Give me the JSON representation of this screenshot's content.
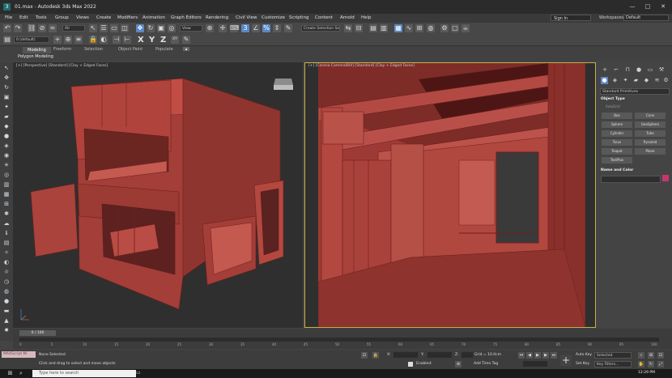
{
  "window": {
    "title": "01.max - Autodesk 3ds Max 2022",
    "minimize_icon": "minimize-icon",
    "maximize_icon": "maximize-icon",
    "close_icon": "close-icon"
  },
  "menu": {
    "items": [
      "File",
      "Edit",
      "Tools",
      "Group",
      "Views",
      "Create",
      "Modifiers",
      "Animation",
      "Graph Editors",
      "Rendering",
      "Civil View",
      "Customize",
      "Scripting",
      "Content",
      "Arnold",
      "Help"
    ],
    "sign_in": "Sign In",
    "workspaces_label": "Workspaces:",
    "workspace_value": "Default"
  },
  "toolbar": {
    "filter_all": "All",
    "view_dropdown": "View",
    "create_selection_set": "Create Selection Se",
    "axis_x": "X",
    "axis_y": "Y",
    "axis_z": "Z",
    "xy_label": "XY",
    "layer_dropdown": "0 (default)"
  },
  "ribbon": {
    "tabs": [
      "Modeling",
      "Freeform",
      "Selection",
      "Object Paint",
      "Populate"
    ],
    "active_tab": "Modeling",
    "sub_label": "Polygon Modeling"
  },
  "viewports": {
    "left_label": "[+] [Perspective] [Standard] [Clay + Edged Faces]",
    "right_label": "[+] [Corona Camera004] [Standard] [Clay + Edged Faces]"
  },
  "command_panel": {
    "category_dropdown": "Standard Primitives",
    "object_type_title": "Object Type",
    "autogrid_label": "AutoGrid",
    "objects": [
      "Box",
      "Cone",
      "Sphere",
      "GeoSphere",
      "Cylinder",
      "Tube",
      "Torus",
      "Pyramid",
      "Teapot",
      "Plane",
      "TextPlus"
    ],
    "name_color_title": "Name and Color",
    "object_color": "#c8356e"
  },
  "timeline": {
    "frame_slider": "0 / 100",
    "ticks": [
      "0",
      "5",
      "10",
      "15",
      "20",
      "25",
      "30",
      "35",
      "40",
      "45",
      "50",
      "55",
      "60",
      "65",
      "70",
      "75",
      "80",
      "85",
      "90",
      "95",
      "100"
    ]
  },
  "status": {
    "maxscript": "MAXScript Mi",
    "selection_info": "None Selected",
    "prompt": "Click and drag to select and move objects",
    "x_label": "X:",
    "y_label": "Y:",
    "z_label": "Z:",
    "grid": "Grid = 10.0cm",
    "enabled_label": "Enabled:",
    "add_time_tag": "Add Time Tag",
    "auto_key": "Auto Key",
    "set_key": "Set Key",
    "selected_dropdown": "Selected",
    "key_filters": "Key Filters..."
  },
  "taskbar": {
    "search_placeholder": "Type here to search",
    "clock": "12:29 PM"
  }
}
